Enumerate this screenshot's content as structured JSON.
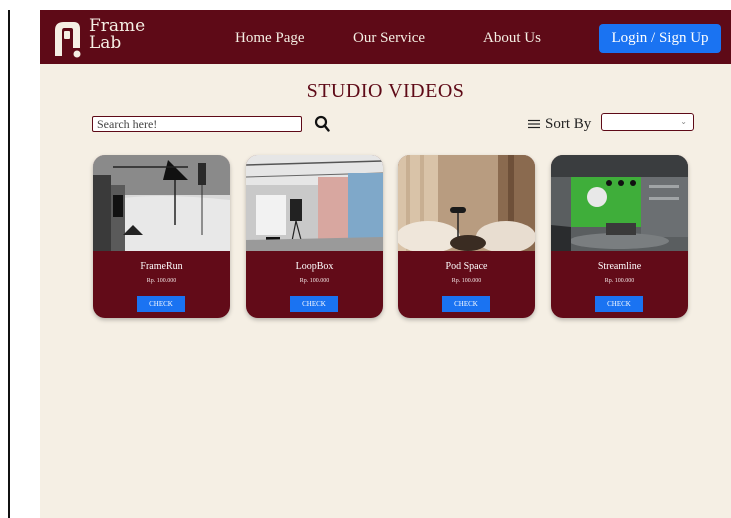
{
  "brand": {
    "name_line1": "Frame",
    "name_line2": "Lab"
  },
  "nav": {
    "links": [
      {
        "label": "Home Page"
      },
      {
        "label": "Our Service"
      },
      {
        "label": "About Us"
      }
    ],
    "login_label": "Login / Sign Up"
  },
  "page": {
    "title": "STUDIO VIDEOS"
  },
  "search": {
    "placeholder": "Search here!",
    "icon": "search-icon"
  },
  "sort": {
    "label": "Sort By",
    "icon": "sort-lines-icon",
    "selected": ""
  },
  "studios": [
    {
      "name": "FrameRun",
      "price": "Rp. 100.000",
      "button": "CHECK"
    },
    {
      "name": "LoopBox",
      "price": "Rp. 100.000",
      "button": "CHECK"
    },
    {
      "name": "Pod Space",
      "price": "Rp. 100.000",
      "button": "CHECK"
    },
    {
      "name": "Streamline",
      "price": "Rp. 100.000",
      "button": "CHECK"
    }
  ],
  "colors": {
    "primary": "#5e0a17",
    "accent": "#1a73f2",
    "background": "#f5efe4"
  }
}
